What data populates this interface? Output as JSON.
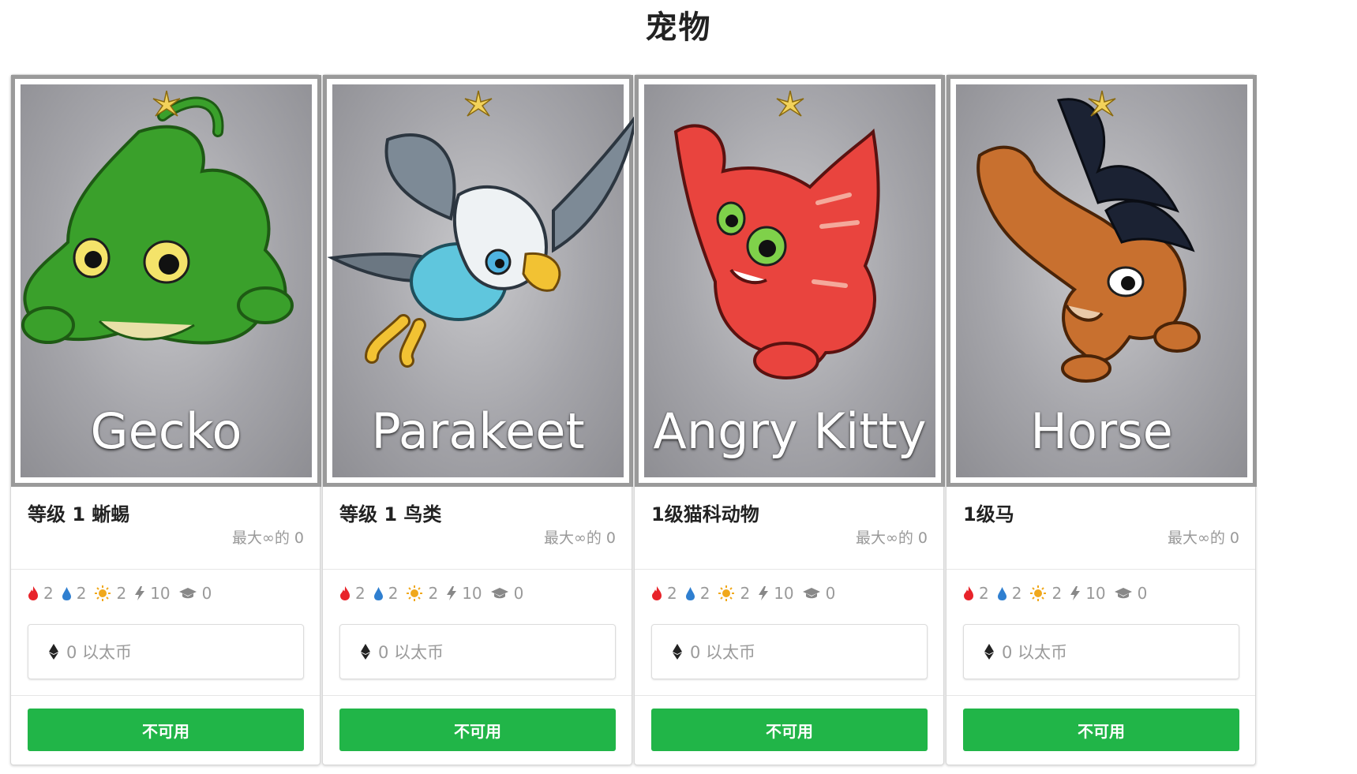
{
  "page": {
    "title": "宠物"
  },
  "colors": {
    "button": "#21b548",
    "fire": "#e8232a",
    "water": "#2f7fd0",
    "sun": "#f0a81c",
    "frame": "#9a9a9a"
  },
  "cards": [
    {
      "name": "Gecko",
      "title": "等级 1 蜥蜴",
      "supply": "最大∞的 0",
      "stats": {
        "fire": "2",
        "water": "2",
        "sun": "2",
        "energy": "10",
        "education": "0"
      },
      "price": "0 以太币",
      "button": "不可用",
      "icon": "gecko-creature",
      "color": "#3aa02b"
    },
    {
      "name": "Parakeet",
      "title": "等级 1 鸟类",
      "supply": "最大∞的 0",
      "stats": {
        "fire": "2",
        "water": "2",
        "sun": "2",
        "energy": "10",
        "education": "0"
      },
      "price": "0 以太币",
      "button": "不可用",
      "icon": "parakeet-creature",
      "color": "#5fc6dd"
    },
    {
      "name": "Angry Kitty",
      "title": "1级猫科动物",
      "supply": "最大∞的 0",
      "stats": {
        "fire": "2",
        "water": "2",
        "sun": "2",
        "energy": "10",
        "education": "0"
      },
      "price": "0 以太币",
      "button": "不可用",
      "icon": "angry-kitty-creature",
      "color": "#e9443e"
    },
    {
      "name": "Horse",
      "title": "1级马",
      "supply": "最大∞的 0",
      "stats": {
        "fire": "2",
        "water": "2",
        "sun": "2",
        "energy": "10",
        "education": "0"
      },
      "price": "0 以太币",
      "button": "不可用",
      "icon": "horse-creature",
      "color": "#c8702f"
    }
  ]
}
